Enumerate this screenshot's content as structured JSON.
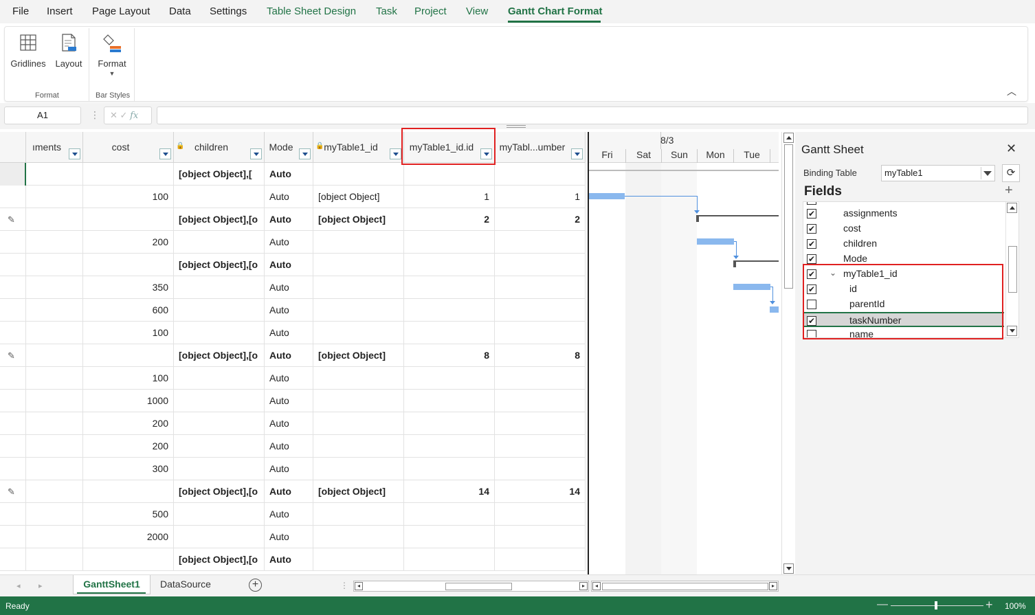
{
  "menu": {
    "file": "File",
    "insert": "Insert",
    "page_layout": "Page Layout",
    "data": "Data",
    "settings": "Settings",
    "table_sheet_design": "Table Sheet Design",
    "task": "Task",
    "project": "Project",
    "view": "View",
    "gantt_chart_format": "Gantt Chart Format"
  },
  "ribbon": {
    "gridlines": "Gridlines",
    "layout": "Layout",
    "format": "Format",
    "group_format": "Format",
    "group_bar_styles": "Bar Styles"
  },
  "formula_bar": {
    "name_box": "A1",
    "fx": "fx",
    "value": ""
  },
  "grid": {
    "columns": [
      {
        "label": "ıments",
        "lock": false
      },
      {
        "label": "cost",
        "lock": false
      },
      {
        "label": "children",
        "lock": true
      },
      {
        "label": "Mode",
        "lock": false
      },
      {
        "label": "myTable1_id",
        "lock": true
      },
      {
        "label": "myTable1_id.id",
        "lock": false
      },
      {
        "label": "myTabl...umber",
        "lock": false
      }
    ],
    "rows": [
      {
        "edit": false,
        "bold": true,
        "cells": [
          "",
          "",
          "[object Object],[",
          "Auto",
          "",
          "",
          ""
        ]
      },
      {
        "edit": false,
        "bold": false,
        "cells": [
          "",
          "100",
          "",
          "Auto",
          "[object Object]",
          "1",
          "1"
        ]
      },
      {
        "edit": true,
        "bold": true,
        "cells": [
          "",
          "",
          "[object Object],[o",
          "Auto",
          "[object Object]",
          "2",
          "2"
        ]
      },
      {
        "edit": false,
        "bold": false,
        "cells": [
          "",
          "200",
          "",
          "Auto",
          "",
          "",
          ""
        ]
      },
      {
        "edit": false,
        "bold": true,
        "cells": [
          "",
          "",
          "[object Object],[o",
          "Auto",
          "",
          "",
          ""
        ]
      },
      {
        "edit": false,
        "bold": false,
        "cells": [
          "",
          "350",
          "",
          "Auto",
          "",
          "",
          ""
        ]
      },
      {
        "edit": false,
        "bold": false,
        "cells": [
          "",
          "600",
          "",
          "Auto",
          "",
          "",
          ""
        ]
      },
      {
        "edit": false,
        "bold": false,
        "cells": [
          "",
          "100",
          "",
          "Auto",
          "",
          "",
          ""
        ]
      },
      {
        "edit": true,
        "bold": true,
        "cells": [
          "",
          "",
          "[object Object],[o",
          "Auto",
          "[object Object]",
          "8",
          "8"
        ]
      },
      {
        "edit": false,
        "bold": false,
        "cells": [
          "",
          "100",
          "",
          "Auto",
          "",
          "",
          ""
        ]
      },
      {
        "edit": false,
        "bold": false,
        "cells": [
          "",
          "1000",
          "",
          "Auto",
          "",
          "",
          ""
        ]
      },
      {
        "edit": false,
        "bold": false,
        "cells": [
          "",
          "200",
          "",
          "Auto",
          "",
          "",
          ""
        ]
      },
      {
        "edit": false,
        "bold": false,
        "cells": [
          "",
          "200",
          "",
          "Auto",
          "",
          "",
          ""
        ]
      },
      {
        "edit": false,
        "bold": false,
        "cells": [
          "",
          "300",
          "",
          "Auto",
          "",
          "",
          ""
        ]
      },
      {
        "edit": true,
        "bold": true,
        "cells": [
          "",
          "",
          "[object Object],[o",
          "Auto",
          "[object Object]",
          "14",
          "14"
        ]
      },
      {
        "edit": false,
        "bold": false,
        "cells": [
          "",
          "500",
          "",
          "Auto",
          "",
          "",
          ""
        ]
      },
      {
        "edit": false,
        "bold": false,
        "cells": [
          "",
          "2000",
          "",
          "Auto",
          "",
          "",
          ""
        ]
      },
      {
        "edit": false,
        "bold": true,
        "cells": [
          "",
          "",
          "[object Object],[o",
          "Auto",
          "",
          "",
          ""
        ]
      }
    ]
  },
  "gantt": {
    "week_label": "8/3",
    "days": [
      "Fri",
      "Sat",
      "Sun",
      "Mon",
      "Tue"
    ]
  },
  "panel": {
    "title": "Gantt Sheet",
    "close": "✕",
    "binding_table_label": "Binding Table",
    "binding_table_value": "myTable1",
    "fields_label": "Fields",
    "add": "+",
    "refresh": "⟳",
    "fields": [
      {
        "label": "assignments",
        "checked": true,
        "indent": 0,
        "expander": false
      },
      {
        "label": "cost",
        "checked": true,
        "indent": 0,
        "expander": false
      },
      {
        "label": "children",
        "checked": true,
        "indent": 0,
        "expander": false
      },
      {
        "label": "Mode",
        "checked": true,
        "indent": 0,
        "expander": false
      },
      {
        "label": "myTable1_id",
        "checked": true,
        "indent": 0,
        "expander": true
      },
      {
        "label": "id",
        "checked": true,
        "indent": 1,
        "expander": false
      },
      {
        "label": "parentId",
        "checked": false,
        "indent": 1,
        "expander": false
      },
      {
        "label": "taskNumber",
        "checked": true,
        "indent": 1,
        "expander": false,
        "selected": true
      },
      {
        "label": "name",
        "checked": false,
        "indent": 1,
        "expander": false
      }
    ]
  },
  "tabs": {
    "sheet1": "GanttSheet1",
    "sheet2": "DataSource",
    "add": "+"
  },
  "status": {
    "text": "Ready",
    "zoom": "100%",
    "zoom_minus": "—",
    "zoom_plus": "+"
  }
}
